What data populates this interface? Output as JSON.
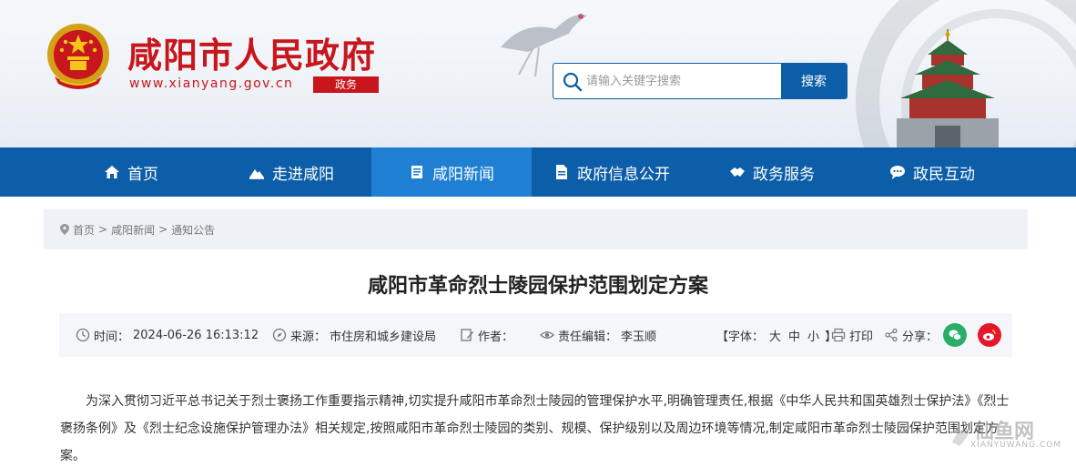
{
  "header": {
    "site_title": "咸阳市人民政府",
    "site_url": "www.xianyang.gov.cn",
    "site_tag": "政务",
    "search": {
      "placeholder": "请输入关键字搜索",
      "button_label": "搜索"
    }
  },
  "nav": {
    "items": [
      {
        "label": "首页",
        "icon": "home-icon"
      },
      {
        "label": "走进咸阳",
        "icon": "mountain-icon"
      },
      {
        "label": "咸阳新闻",
        "icon": "news-icon",
        "active": true
      },
      {
        "label": "政府信息公开",
        "icon": "document-icon"
      },
      {
        "label": "政务服务",
        "icon": "handshake-icon"
      },
      {
        "label": "政民互动",
        "icon": "chat-icon"
      }
    ]
  },
  "breadcrumb": {
    "items": [
      "首页",
      "咸阳新闻",
      "通知公告"
    ],
    "separator": ">"
  },
  "article": {
    "title": "咸阳市革命烈士陵园保护范围划定方案",
    "meta": {
      "time_label": "时间：",
      "time_value": "2024-06-26 16:13:12",
      "source_label": "来源：",
      "source_value": "市住房和城乡建设局",
      "author_label": "作者：",
      "editor_label": "责任编辑：",
      "editor_value": "李玉顺",
      "font_label": "【字体：",
      "font_large": "大",
      "font_medium": "中",
      "font_small": "小",
      "font_close": "】",
      "print_label": "打印",
      "share_label": "分享："
    },
    "paragraph_1": "为深入贯彻习近平总书记关于烈士褒扬工作重要指示精神,切实提升咸阳市革命烈士陵园的管理保护水平,明确管理责任,根据《中华人民共和国英雄烈士保护法》《烈士褒扬条例》及《烈士纪念设施保护管理办法》相关规定,按照咸阳市革命烈士陵园的类别、规模、保护级别以及周边环境等情况,制定咸阳市革命烈士陵园保护范围划定方案。"
  },
  "watermark": {
    "text": "仙鱼网",
    "url": "XIANYUWANG.COM"
  },
  "colors": {
    "brand_red": "#c8161d",
    "nav_blue": "#0d5ea8",
    "nav_active": "#1e7fd3",
    "wechat_green": "#2aae67",
    "weibo_red": "#e6162d"
  }
}
